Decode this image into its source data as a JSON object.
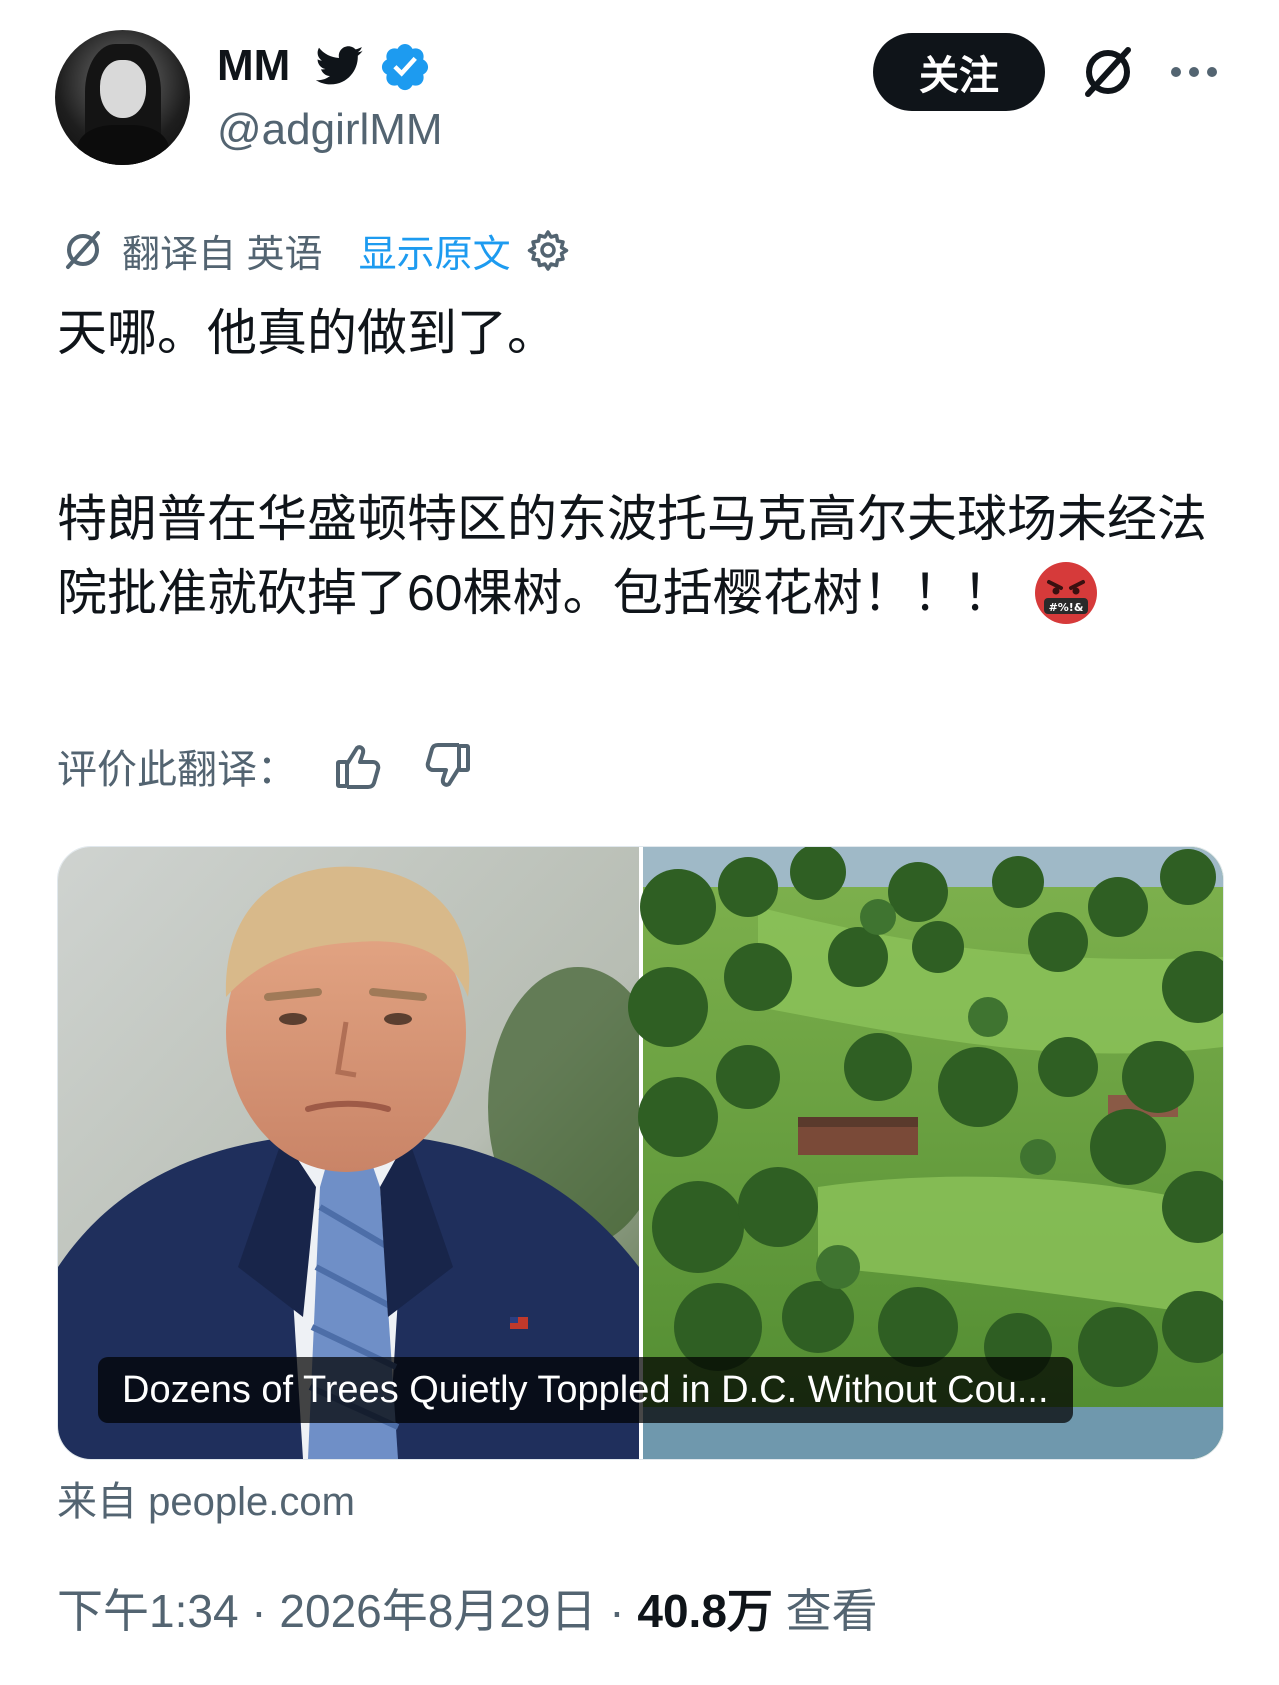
{
  "author": {
    "display_name": "MM",
    "handle": "@adgirlMM",
    "bird_icon": "twitter-bird-icon",
    "verified_icon": "verified-badge-icon",
    "brand_color": "#1d9bf0"
  },
  "actions": {
    "follow_label": "关注",
    "grok_icon": "grok-slash-icon",
    "more_icon": "more-dots-icon"
  },
  "translation": {
    "icon": "translate-icon",
    "from_label": "翻译自 英语",
    "show_original": "显示原文",
    "settings_icon": "gear-icon"
  },
  "tweet": {
    "line1": "天哪。他真的做到了。",
    "line2": "特朗普在华盛顿特区的东波托马克高尔夫球场未经法院批准就砍掉了60棵树。包括樱花树！！！",
    "emoji": "angry-cursing-face-emoji",
    "emoji_text": "#%!&"
  },
  "rate": {
    "label": "评价此翻译：",
    "up_icon": "thumbs-up-icon",
    "down_icon": "thumbs-down-icon"
  },
  "card": {
    "caption": "Dozens of Trees Quietly Toppled in D.C. Without Cou...",
    "source": "来自 people.com"
  },
  "meta": {
    "time_date": "下午1:34 · 2026年8月29日 · ",
    "views_count": "40.8万",
    "views_label": " 查看"
  }
}
